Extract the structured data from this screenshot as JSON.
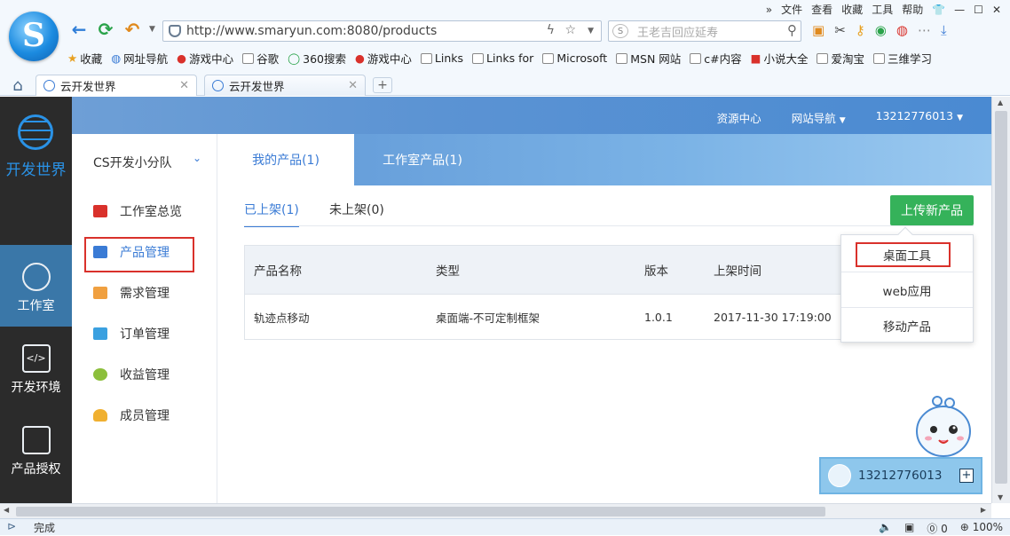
{
  "browser": {
    "menu": [
      "文件",
      "查看",
      "收藏",
      "工具",
      "帮助"
    ],
    "url": "http://www.smaryun.com:8080/products",
    "search_placeholder": "王老吉回应延寿",
    "bookmarks": [
      "收藏",
      "网址导航",
      "游戏中心",
      "谷歌",
      "360搜索",
      "游戏中心",
      "Links",
      "Links for",
      "Microsoft",
      "MSN 网站",
      "c#内容",
      "小说大全",
      "爱淘宝",
      "三维学习"
    ],
    "tabs": [
      {
        "label": "云开发世界"
      },
      {
        "label": "云开发世界"
      }
    ],
    "status_text": "完成",
    "status_count": "0",
    "zoom": "100%"
  },
  "sidebar": {
    "logo_text": "开发世界",
    "items": [
      {
        "label": "工作室"
      },
      {
        "label": "开发环境"
      },
      {
        "label": "产品授权"
      }
    ]
  },
  "header": {
    "resource_center": "资源中心",
    "site_nav": "网站导航",
    "user": "13212776013"
  },
  "studio": {
    "team": "CS开发小分队",
    "menu": [
      {
        "label": "工作室总览",
        "color": "#d9312b"
      },
      {
        "label": "产品管理",
        "color": "#3a7bd5"
      },
      {
        "label": "需求管理",
        "color": "#f0a040"
      },
      {
        "label": "订单管理",
        "color": "#3aa0e0"
      },
      {
        "label": "收益管理",
        "color": "#8cbf3c"
      },
      {
        "label": "成员管理",
        "color": "#f0b030"
      }
    ]
  },
  "main": {
    "tabs": [
      "我的产品(1)",
      "工作室产品(1)"
    ],
    "subtabs": [
      "已上架(1)",
      "未上架(0)"
    ],
    "upload_button": "上传新产品",
    "table": {
      "headers": [
        "产品名称",
        "类型",
        "版本",
        "上架时间"
      ],
      "rows": [
        [
          "轨迹点移动",
          "桌面端-不可定制框架",
          "1.0.1",
          "2017-11-30 17:19:00"
        ]
      ]
    },
    "dropdown": [
      "桌面工具",
      "web应用",
      "移动产品"
    ]
  },
  "chat": {
    "user": "13212776013"
  }
}
